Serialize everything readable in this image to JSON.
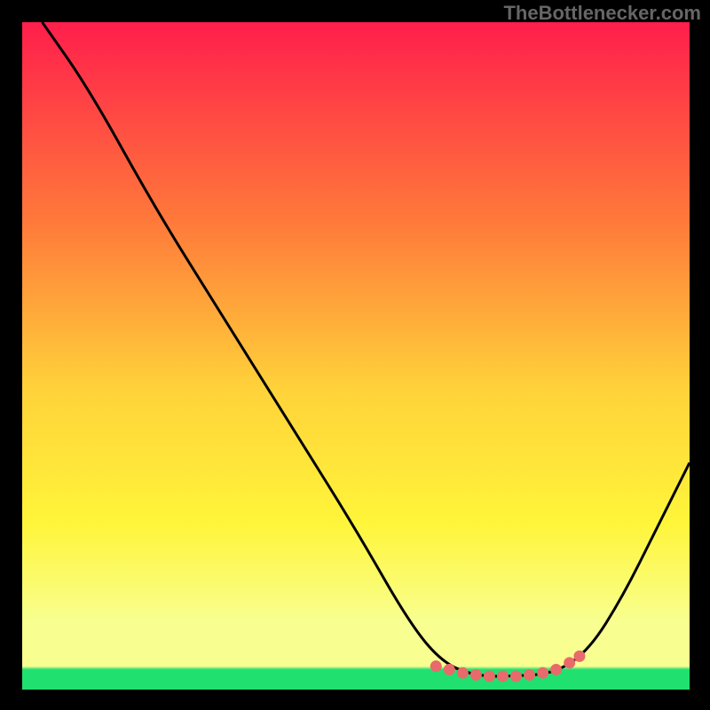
{
  "attribution": "TheBottlenecker.com",
  "colors": {
    "top": "#ff1e4c",
    "mid_upper": "#ff7a3a",
    "mid": "#ffd23a",
    "mid_lower": "#fff53a",
    "low_yellow": "#f8ff90",
    "green": "#20e070",
    "curve": "#000000",
    "dot": "#e96a6a",
    "bg": "#000000"
  },
  "chart_data": {
    "type": "line",
    "title": "",
    "xlabel": "",
    "ylabel": "",
    "xlim": [
      0,
      100
    ],
    "ylim": [
      0,
      100
    ],
    "series": [
      {
        "name": "bottleneck-curve",
        "points": [
          {
            "x": 3,
            "y": 100
          },
          {
            "x": 10,
            "y": 90
          },
          {
            "x": 20,
            "y": 72
          },
          {
            "x": 30,
            "y": 56
          },
          {
            "x": 40,
            "y": 40
          },
          {
            "x": 50,
            "y": 24
          },
          {
            "x": 58,
            "y": 10
          },
          {
            "x": 63,
            "y": 4
          },
          {
            "x": 68,
            "y": 2
          },
          {
            "x": 74,
            "y": 2
          },
          {
            "x": 80,
            "y": 2.5
          },
          {
            "x": 85,
            "y": 6
          },
          {
            "x": 90,
            "y": 14
          },
          {
            "x": 95,
            "y": 24
          },
          {
            "x": 100,
            "y": 34
          }
        ]
      },
      {
        "name": "optimal-zone-dots",
        "points": [
          {
            "x": 62,
            "y": 3.5
          },
          {
            "x": 64,
            "y": 3
          },
          {
            "x": 66,
            "y": 2.5
          },
          {
            "x": 68,
            "y": 2.2
          },
          {
            "x": 70,
            "y": 2
          },
          {
            "x": 72,
            "y": 2
          },
          {
            "x": 74,
            "y": 2
          },
          {
            "x": 76,
            "y": 2.2
          },
          {
            "x": 78,
            "y": 2.5
          },
          {
            "x": 80,
            "y": 3
          },
          {
            "x": 82,
            "y": 4
          },
          {
            "x": 83.5,
            "y": 5
          }
        ]
      }
    ]
  }
}
